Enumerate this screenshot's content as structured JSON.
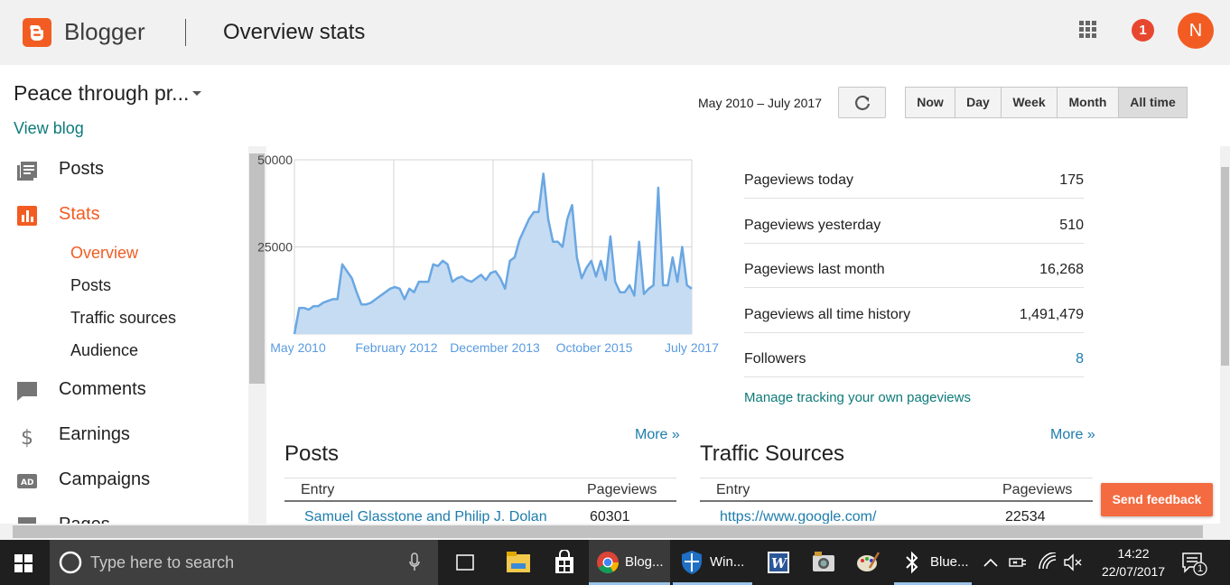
{
  "header": {
    "brand": "Blogger",
    "page_title": "Overview stats",
    "notifications_count": "1",
    "avatar_letter": "N"
  },
  "sidebar": {
    "blog_name": "Peace through pr...",
    "view_blog": "View blog",
    "items": [
      {
        "label": "Posts",
        "icon": "posts-icon"
      },
      {
        "label": "Stats",
        "icon": "stats-icon"
      },
      {
        "label": "Comments",
        "icon": "comments-icon"
      },
      {
        "label": "Earnings",
        "icon": "dollar-icon"
      },
      {
        "label": "Campaigns",
        "icon": "ad-icon"
      },
      {
        "label": "Pages",
        "icon": "pages-icon"
      }
    ],
    "stats_sub": [
      "Overview",
      "Posts",
      "Traffic sources",
      "Audience"
    ]
  },
  "toolbar": {
    "range": "May 2010 – July 2017",
    "periods": [
      "Now",
      "Day",
      "Week",
      "Month",
      "All time"
    ],
    "active_period": "All time"
  },
  "chart_data": {
    "type": "area",
    "ylim": [
      0,
      50000
    ],
    "y_ticks": [
      "50000",
      "25000"
    ],
    "x_ticks": [
      "May 2010",
      "February 2012",
      "December 2013",
      "October 2015",
      "July 2017"
    ],
    "values": [
      0,
      7500,
      7500,
      7000,
      8000,
      8000,
      9000,
      9500,
      10000,
      10000,
      20000,
      18000,
      16000,
      12000,
      8500,
      8500,
      9000,
      10000,
      11000,
      12000,
      13000,
      13500,
      13000,
      10000,
      13000,
      12000,
      15000,
      15000,
      15000,
      20000,
      19500,
      21000,
      20000,
      15000,
      16000,
      16500,
      15500,
      15000,
      16000,
      17000,
      15500,
      17500,
      18000,
      16000,
      13000,
      21000,
      22000,
      27000,
      30000,
      33000,
      35000,
      35000,
      46000,
      33000,
      26500,
      26500,
      25000,
      33000,
      37000,
      22000,
      16000,
      19000,
      21000,
      16500,
      21000,
      15500,
      28000,
      15000,
      12000,
      12000,
      14000,
      11000,
      26500,
      11500,
      13000,
      14000,
      42000,
      14000,
      14000,
      22000,
      15000,
      25000,
      14000,
      13000
    ],
    "color": "#6aa7e2"
  },
  "overview": {
    "rows": [
      {
        "label": "Pageviews today",
        "value": "175"
      },
      {
        "label": "Pageviews yesterday",
        "value": "510"
      },
      {
        "label": "Pageviews last month",
        "value": "16,268"
      },
      {
        "label": "Pageviews all time history",
        "value": "1,491,479"
      },
      {
        "label": "Followers",
        "value": "8"
      }
    ],
    "manage_link": "Manage tracking your own pageviews"
  },
  "posts_section": {
    "title": "Posts",
    "more": "More »",
    "col_entry": "Entry",
    "col_pageviews": "Pageviews",
    "rows": [
      {
        "entry": "Samuel Glasstone and Philip J. Dolan",
        "pageviews": "60301"
      }
    ]
  },
  "traffic_section": {
    "title": "Traffic Sources",
    "more": "More »",
    "col_entry": "Entry",
    "col_pageviews": "Pageviews",
    "rows": [
      {
        "entry": "https://www.google.com/",
        "pageviews": "22534"
      }
    ]
  },
  "feedback_button": "Send feedback",
  "taskbar": {
    "search_placeholder": "Type here to search",
    "apps": [
      {
        "label": "Blog...",
        "icon": "chrome-icon"
      },
      {
        "label": "Win...",
        "icon": "shield-icon"
      },
      {
        "label": "",
        "icon": "word-icon"
      },
      {
        "label": "",
        "icon": "photos-icon"
      },
      {
        "label": "",
        "icon": "paint-icon"
      },
      {
        "label": "Blue...",
        "icon": "bluetooth-icon"
      }
    ],
    "time": "14:22",
    "date": "22/07/2017",
    "notification_count": "1"
  }
}
